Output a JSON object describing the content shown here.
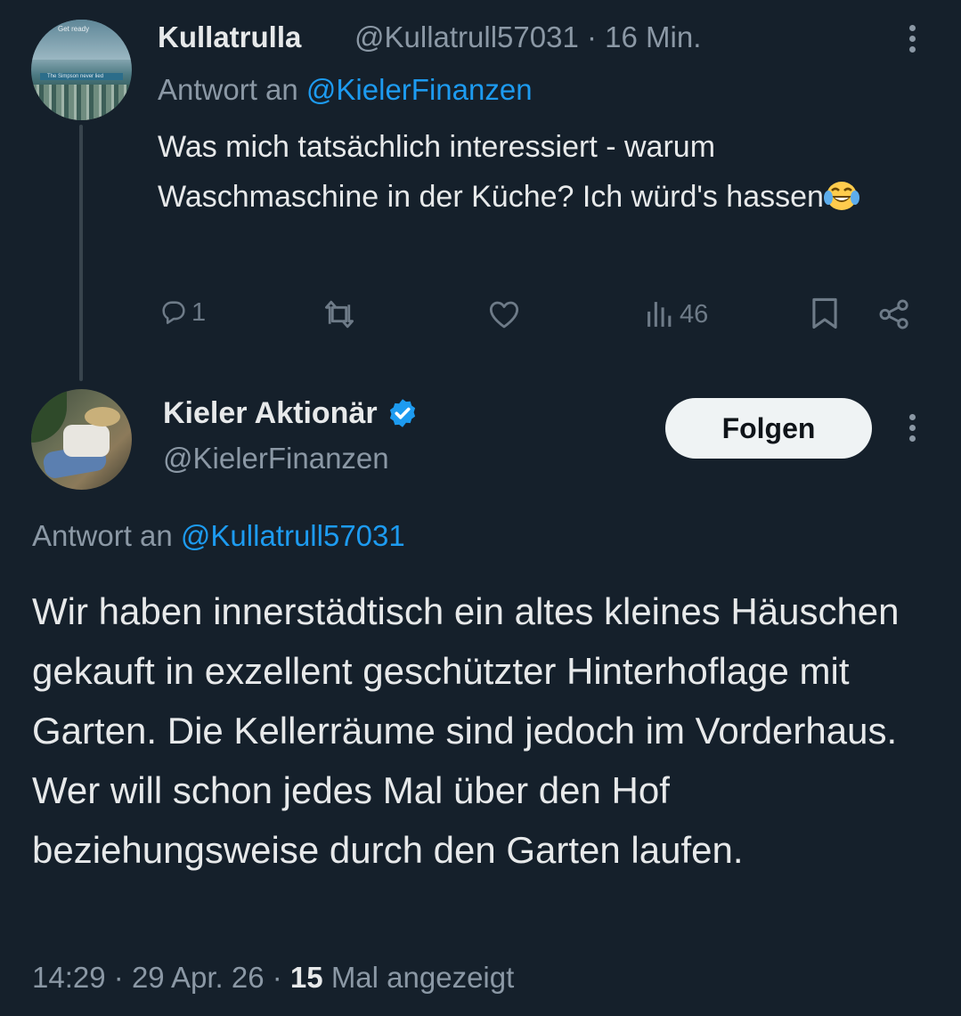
{
  "reply_tweet": {
    "avatar_banner_top": "Get ready",
    "avatar_banner_text": "The Simpson never lied",
    "author_name": "Kullatrulla",
    "author_handle": "@Kullatrull57031",
    "separator": "·",
    "time_ago": "16 Min.",
    "reply_prefix": "Antwort an",
    "reply_to": "@KielerFinanzen",
    "text": "Was mich tatsächlich interessiert - warum Waschmaschine in der Küche? Ich würd's hassen",
    "emoji": "face-with-tears-of-joy",
    "actions": {
      "reply_count": "1",
      "views_count": "46"
    }
  },
  "main_tweet": {
    "author_name": "Kieler Aktionär",
    "verified": true,
    "author_handle": "@KielerFinanzen",
    "follow_label": "Folgen",
    "reply_prefix": "Antwort an",
    "reply_to": "@Kullatrull57031",
    "text": "Wir haben innerstädtisch ein altes kleines Häuschen gekauft in exzellent geschützter Hinterhoflage mit Garten. Die Kellerräume sind jedoch im Vorderhaus. Wer will schon jedes Mal über den Hof beziehungsweise durch den Garten laufen.",
    "time": "14:29",
    "date": "29 Apr. 26",
    "separator": "·",
    "views_count": "15",
    "views_label": "Mal angezeigt"
  },
  "colors": {
    "background": "#15202b",
    "primary_text": "#e7e9ea",
    "secondary_text": "#8b98a5",
    "link": "#1d9bf0",
    "verified_badge": "#1d9bf0",
    "follow_button_bg": "#eff3f4"
  },
  "icons": [
    "reply-icon",
    "retweet-icon",
    "like-icon",
    "views-icon",
    "bookmark-icon",
    "share-icon",
    "more-icon",
    "verified-badge-icon"
  ]
}
